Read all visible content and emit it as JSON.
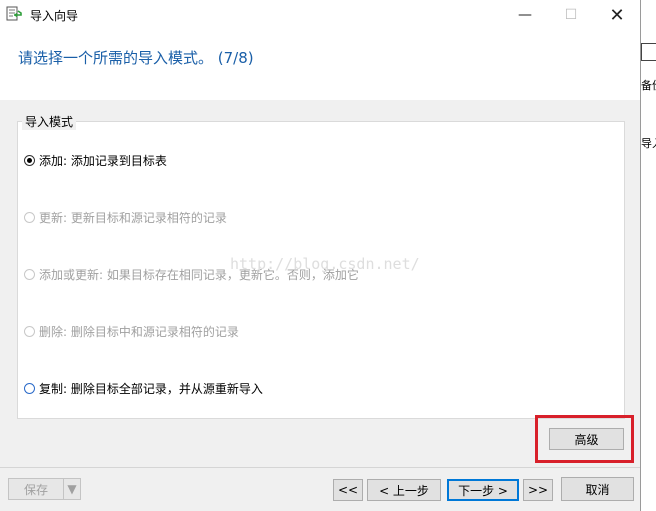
{
  "window": {
    "title": "导入向导",
    "min_symbol": "—",
    "max_symbol": "☐",
    "close_symbol": "✕"
  },
  "header": {
    "text": "请选择一个所需的导入模式。 (7/8)"
  },
  "group": {
    "title": "导入模式",
    "options": [
      {
        "label": "添加: 添加记录到目标表",
        "state": "checked"
      },
      {
        "label": "更新: 更新目标和源记录相符的记录",
        "state": "disabled"
      },
      {
        "label": "添加或更新: 如果目标存在相同记录，更新它。否则，添加它",
        "state": "disabled"
      },
      {
        "label": "删除: 删除目标中和源记录相符的记录",
        "state": "disabled"
      },
      {
        "label": "复制: 删除目标全部记录，并从源重新导入",
        "state": "enabled"
      }
    ]
  },
  "advanced_button": "高级",
  "footer": {
    "save": "保存",
    "save_arrow": "▼",
    "first": "<<",
    "prev": "< 上一步",
    "next": "下一步 >",
    "last": ">>",
    "cancel": "取消"
  },
  "watermark": "http://blog.csdn.net/",
  "background_window": {
    "text1": "备份",
    "text2": "导入"
  },
  "icons": {
    "title_icon": "import-wizard-icon"
  },
  "colors": {
    "header_text": "#1a5fa8",
    "highlight": "#d8202a",
    "primary_border": "#0078d7"
  }
}
